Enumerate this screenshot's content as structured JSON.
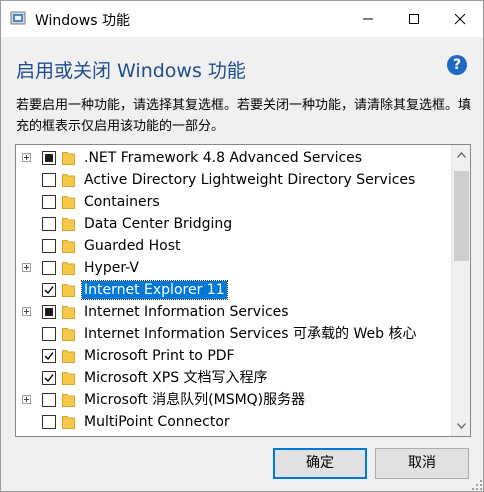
{
  "window": {
    "title": "Windows 功能",
    "controls": {
      "minimize": "minimize",
      "maximize": "maximize",
      "close": "close"
    }
  },
  "heading": "启用或关闭 Windows 功能",
  "help_label": "?",
  "description": "若要启用一种功能，请选择其复选框。若要关闭一种功能，请清除其复选框。填充的框表示仅启用该功能的一部分。",
  "features": [
    {
      "label": ".NET Framework 4.8 Advanced Services",
      "expandable": true,
      "state": "partial",
      "selected": false
    },
    {
      "label": "Active Directory Lightweight Directory Services",
      "expandable": false,
      "state": "unchecked",
      "selected": false
    },
    {
      "label": "Containers",
      "expandable": false,
      "state": "unchecked",
      "selected": false
    },
    {
      "label": "Data Center Bridging",
      "expandable": false,
      "state": "unchecked",
      "selected": false
    },
    {
      "label": "Guarded Host",
      "expandable": false,
      "state": "unchecked",
      "selected": false
    },
    {
      "label": "Hyper-V",
      "expandable": true,
      "state": "unchecked",
      "selected": false
    },
    {
      "label": "Internet Explorer 11",
      "expandable": false,
      "state": "checked",
      "selected": true
    },
    {
      "label": "Internet Information Services",
      "expandable": true,
      "state": "partial",
      "selected": false
    },
    {
      "label": "Internet Information Services 可承载的 Web 核心",
      "expandable": false,
      "state": "unchecked",
      "selected": false
    },
    {
      "label": "Microsoft Print to PDF",
      "expandable": false,
      "state": "checked",
      "selected": false
    },
    {
      "label": "Microsoft XPS 文档写入程序",
      "expandable": false,
      "state": "checked",
      "selected": false
    },
    {
      "label": "Microsoft 消息队列(MSMQ)服务器",
      "expandable": true,
      "state": "unchecked",
      "selected": false
    },
    {
      "label": "MultiPoint Connector",
      "expandable": false,
      "state": "unchecked",
      "selected": false
    },
    {
      "label": "",
      "expandable": true,
      "state": "unchecked",
      "selected": false
    }
  ],
  "buttons": {
    "ok": "确定",
    "cancel": "取消"
  },
  "colors": {
    "accent": "#0078d7",
    "heading": "#1f4e8c",
    "folder": "#f5c84c",
    "selection": "#0078d7"
  }
}
